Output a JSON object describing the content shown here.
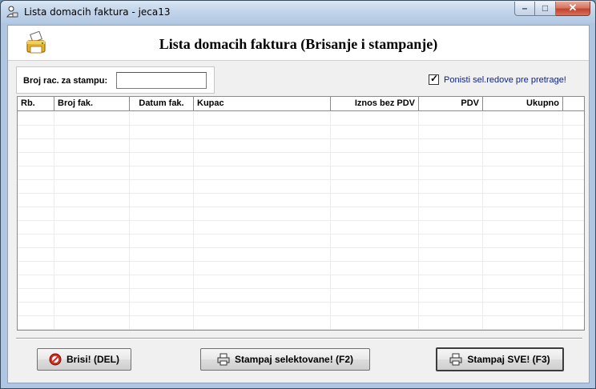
{
  "window": {
    "title": "Lista domacih faktura - jeca13",
    "icons": {
      "app": "printer-user-icon",
      "minimize": "minimize-icon",
      "maximize": "maximize-icon",
      "close": "close-icon"
    }
  },
  "header": {
    "title": "Lista domacih faktura (Brisanje i stampanje)",
    "icon": "printer-icon"
  },
  "search": {
    "label": "Broj rac. za stampu:",
    "value": "",
    "placeholder": ""
  },
  "reset_selection": {
    "label": "Ponisti sel.redove pre pretrage!",
    "checked": true
  },
  "grid": {
    "columns": [
      "Rb.",
      "Broj fak.",
      "Datum fak.",
      "Kupac",
      "Iznos bez PDV",
      "PDV",
      "Ukupno"
    ],
    "rows": []
  },
  "buttons": {
    "delete": {
      "label": "Brisi! (DEL)",
      "icon": "delete-icon"
    },
    "print_selected": {
      "label": "Stampaj selektovane! (F2)",
      "icon": "printer-icon"
    },
    "print_all": {
      "label": "Stampaj SVE! (F3)",
      "icon": "printer-icon"
    }
  },
  "colors": {
    "title_text": "#000000",
    "checkbox_label": "#0a1f8f",
    "close_button": "#c4432a"
  }
}
